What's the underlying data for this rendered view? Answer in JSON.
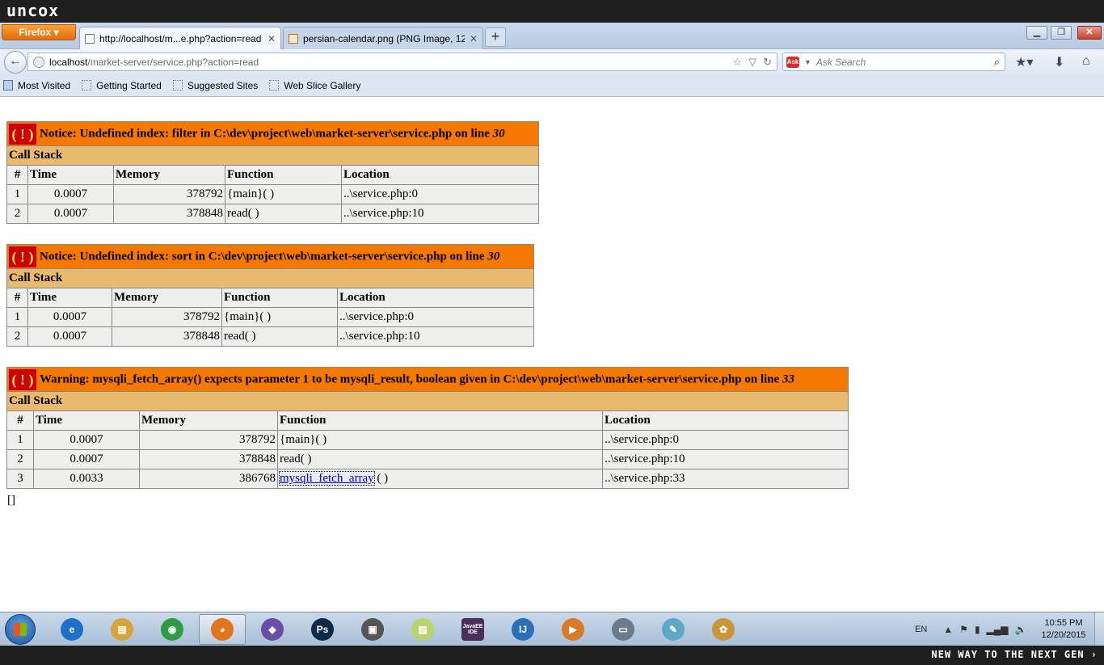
{
  "os": {
    "brand": "uncox",
    "bottom_slogan": "NEW WAY TO THE NEXT GEN ›"
  },
  "browser": {
    "menu_button": "Firefox ▾",
    "tabs": [
      {
        "title": "http://localhost/m...e.php?action=read",
        "active": true
      },
      {
        "title": "persian-calendar.png (PNG Image, 12...",
        "active": false
      }
    ],
    "new_tab": "+",
    "window_controls": {
      "minimize": "▁",
      "maximize": "❐",
      "close": "✕"
    },
    "url": {
      "host": "localhost",
      "path": "/market-server/service.php?action=read"
    },
    "search": {
      "placeholder": "Ask Search",
      "provider_logo": "Ask"
    },
    "bookmarks": [
      "Most Visited",
      "Getting Started",
      "Suggested Sites",
      "Web Slice Gallery"
    ]
  },
  "page": {
    "errors": [
      {
        "badge": "( ! )",
        "message": "Notice: Undefined index: filter in C:\\dev\\project\\web\\market-server\\service.php on line ",
        "line": "30",
        "call_stack_label": "Call Stack",
        "columns": [
          "#",
          "Time",
          "Memory",
          "Function",
          "Location"
        ],
        "rows": [
          {
            "n": "1",
            "time": "0.0007",
            "memory": "378792",
            "function": "{main}( )",
            "location": "..\\service.php:0"
          },
          {
            "n": "2",
            "time": "0.0007",
            "memory": "378848",
            "function": "read( )",
            "location": "..\\service.php:10"
          }
        ]
      },
      {
        "badge": "( ! )",
        "message": "Notice: Undefined index: sort in C:\\dev\\project\\web\\market-server\\service.php on line ",
        "line": "30",
        "call_stack_label": "Call Stack",
        "columns": [
          "#",
          "Time",
          "Memory",
          "Function",
          "Location"
        ],
        "rows": [
          {
            "n": "1",
            "time": "0.0007",
            "memory": "378792",
            "function": "{main}( )",
            "location": "..\\service.php:0"
          },
          {
            "n": "2",
            "time": "0.0007",
            "memory": "378848",
            "function": "read( )",
            "location": "..\\service.php:10"
          }
        ]
      },
      {
        "badge": "( ! )",
        "message": "Warning: mysqli_fetch_array() expects parameter 1 to be mysqli_result, boolean given in C:\\dev\\project\\web\\market-server\\service.php on line ",
        "line": "33",
        "call_stack_label": "Call Stack",
        "columns": [
          "#",
          "Time",
          "Memory",
          "Function",
          "Location"
        ],
        "rows": [
          {
            "n": "1",
            "time": "0.0007",
            "memory": "378792",
            "function": "{main}( )",
            "location": "..\\service.php:0"
          },
          {
            "n": "2",
            "time": "0.0007",
            "memory": "378848",
            "function": "read( )",
            "location": "..\\service.php:10"
          },
          {
            "n": "3",
            "time": "0.0033",
            "memory": "386768",
            "function_link": "mysqli_fetch_array",
            "function_suffix": " ( )",
            "location": "..\\service.php:33"
          }
        ]
      }
    ],
    "output": "[]"
  },
  "taskbar": {
    "apps": [
      {
        "name": "internet-explorer",
        "label": "e",
        "color": "#1e70c9"
      },
      {
        "name": "file-explorer",
        "label": "▤",
        "color": "#d8a43a"
      },
      {
        "name": "chrome",
        "label": "◉",
        "color": "#2e9b47"
      },
      {
        "name": "firefox",
        "label": "◕",
        "color": "#e2741c"
      },
      {
        "name": "visual-studio",
        "label": "◆",
        "color": "#6a4ea5"
      },
      {
        "name": "photoshop",
        "label": "Ps",
        "color": "#0d2a4a"
      },
      {
        "name": "game",
        "label": "▣",
        "color": "#555555"
      },
      {
        "name": "sticky-notes",
        "label": "▨",
        "color": "#b8d46a"
      },
      {
        "name": "java-ee-ide",
        "label": "JavaEE IDE",
        "color": "#4b2e5a"
      },
      {
        "name": "intellij",
        "label": "IJ",
        "color": "#2a6fb8"
      },
      {
        "name": "media-player",
        "label": "▶",
        "color": "#d97b27"
      },
      {
        "name": "window-app",
        "label": "▭",
        "color": "#6b7a8c"
      },
      {
        "name": "notepad",
        "label": "✎",
        "color": "#5fa7c7"
      },
      {
        "name": "paint",
        "label": "✿",
        "color": "#c9963a"
      }
    ],
    "language": "EN",
    "time": "10:55 PM",
    "date": "12/20/2015"
  }
}
